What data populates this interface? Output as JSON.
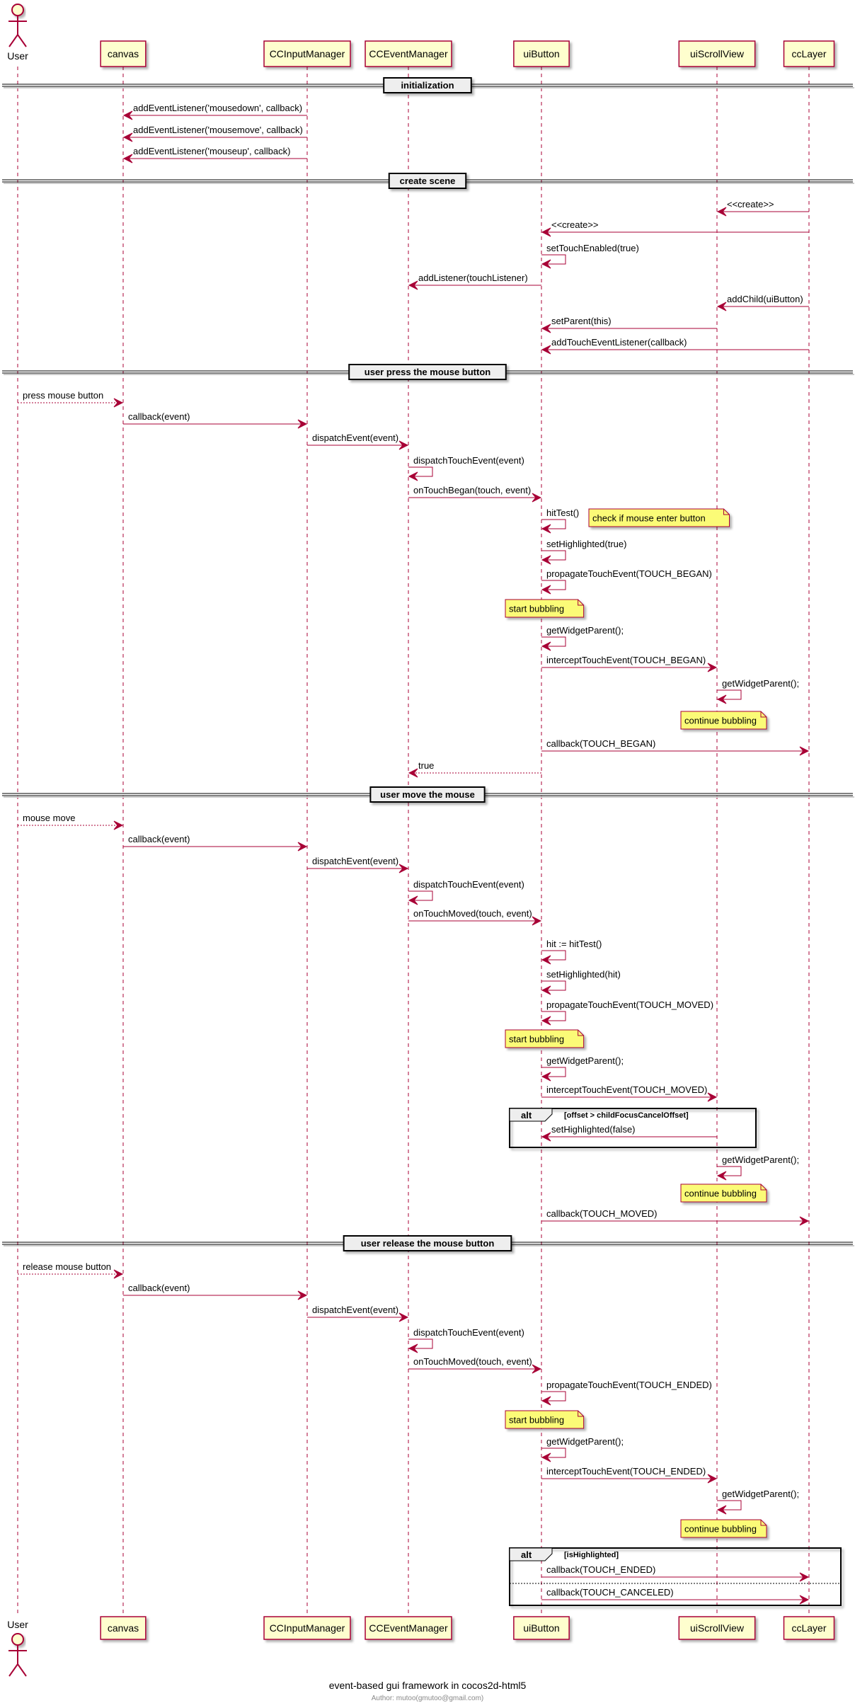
{
  "title": "event-based gui framework in cocos2d-html5",
  "footer": "Author: mutoo(gmutoo@gmail.com)",
  "colors": {
    "line": "#A80036",
    "participant_fill": "#FEFECE",
    "note_fill": "#FBFB77",
    "divider_fill": "#EEEEEE",
    "frame": "#000000"
  },
  "participants": [
    {
      "id": "user",
      "label": "User",
      "kind": "actor"
    },
    {
      "id": "canvas",
      "label": "canvas",
      "kind": "participant"
    },
    {
      "id": "input",
      "label": "CCInputManager",
      "kind": "participant"
    },
    {
      "id": "event",
      "label": "CCEventManager",
      "kind": "participant"
    },
    {
      "id": "button",
      "label": "uiButton",
      "kind": "participant"
    },
    {
      "id": "scroll",
      "label": "uiScrollView",
      "kind": "participant"
    },
    {
      "id": "layer",
      "label": "ccLayer",
      "kind": "participant"
    }
  ],
  "sequence": [
    {
      "type": "divider",
      "label": "initialization"
    },
    {
      "type": "message",
      "from": "input",
      "to": "canvas",
      "label": "addEventListener('mousedown', callback)",
      "style": "solid"
    },
    {
      "type": "message",
      "from": "input",
      "to": "canvas",
      "label": "addEventListener('mousemove', callback)",
      "style": "solid"
    },
    {
      "type": "message",
      "from": "input",
      "to": "canvas",
      "label": "addEventListener('mouseup', callback)",
      "style": "solid"
    },
    {
      "type": "divider",
      "label": "create scene"
    },
    {
      "type": "message",
      "from": "layer",
      "to": "scroll",
      "label": "<<create>>",
      "style": "solid"
    },
    {
      "type": "message",
      "from": "layer",
      "to": "button",
      "label": "<<create>>",
      "style": "solid"
    },
    {
      "type": "self",
      "on": "button",
      "label": "setTouchEnabled(true)"
    },
    {
      "type": "message",
      "from": "button",
      "to": "event",
      "label": "addListener(touchListener)",
      "style": "solid"
    },
    {
      "type": "message",
      "from": "layer",
      "to": "scroll",
      "label": "addChild(uiButton)",
      "style": "solid"
    },
    {
      "type": "message",
      "from": "scroll",
      "to": "button",
      "label": "setParent(this)",
      "style": "solid"
    },
    {
      "type": "message",
      "from": "layer",
      "to": "button",
      "label": "addTouchEventListener(callback)",
      "style": "solid"
    },
    {
      "type": "divider",
      "label": "user press the mouse button"
    },
    {
      "type": "message",
      "from": "user",
      "to": "canvas",
      "label": "press mouse button",
      "style": "dotted"
    },
    {
      "type": "message",
      "from": "canvas",
      "to": "input",
      "label": "callback(event)",
      "style": "solid"
    },
    {
      "type": "message",
      "from": "input",
      "to": "event",
      "label": "dispatchEvent(event)",
      "style": "solid"
    },
    {
      "type": "self",
      "on": "event",
      "label": "dispatchTouchEvent(event)"
    },
    {
      "type": "message",
      "from": "event",
      "to": "button",
      "label": "onTouchBegan(touch, event)",
      "style": "solid"
    },
    {
      "type": "self",
      "on": "button",
      "label": "hitTest()",
      "note": "check if mouse enter button"
    },
    {
      "type": "self",
      "on": "button",
      "label": "setHighlighted(true)"
    },
    {
      "type": "self",
      "on": "button",
      "label": "propagateTouchEvent(TOUCH_BEGAN)"
    },
    {
      "type": "note",
      "over": "button",
      "label": "start bubbling"
    },
    {
      "type": "self",
      "on": "button",
      "label": "getWidgetParent();"
    },
    {
      "type": "message",
      "from": "button",
      "to": "scroll",
      "label": "interceptTouchEvent(TOUCH_BEGAN)",
      "style": "solid"
    },
    {
      "type": "self",
      "on": "scroll",
      "label": "getWidgetParent();"
    },
    {
      "type": "note",
      "over": "scroll",
      "label": "continue bubbling"
    },
    {
      "type": "message",
      "from": "button",
      "to": "layer",
      "label": "callback(TOUCH_BEGAN)",
      "style": "solid"
    },
    {
      "type": "message",
      "from": "button",
      "to": "event",
      "label": "true",
      "style": "dotted"
    },
    {
      "type": "divider",
      "label": "user move the mouse"
    },
    {
      "type": "message",
      "from": "user",
      "to": "canvas",
      "label": "mouse move",
      "style": "dotted"
    },
    {
      "type": "message",
      "from": "canvas",
      "to": "input",
      "label": "callback(event)",
      "style": "solid"
    },
    {
      "type": "message",
      "from": "input",
      "to": "event",
      "label": "dispatchEvent(event)",
      "style": "solid"
    },
    {
      "type": "self",
      "on": "event",
      "label": "dispatchTouchEvent(event)"
    },
    {
      "type": "message",
      "from": "event",
      "to": "button",
      "label": "onTouchMoved(touch, event)",
      "style": "solid"
    },
    {
      "type": "self",
      "on": "button",
      "label": "hit := hitTest()"
    },
    {
      "type": "self",
      "on": "button",
      "label": "setHighlighted(hit)"
    },
    {
      "type": "self",
      "on": "button",
      "label": "propagateTouchEvent(TOUCH_MOVED)"
    },
    {
      "type": "note",
      "over": "button",
      "label": "start bubbling"
    },
    {
      "type": "self",
      "on": "button",
      "label": "getWidgetParent();"
    },
    {
      "type": "message",
      "from": "button",
      "to": "scroll",
      "label": "interceptTouchEvent(TOUCH_MOVED)",
      "style": "solid"
    },
    {
      "type": "alt",
      "keyword": "alt",
      "guard": "[offset > childFocusCancelOffset]",
      "sections": [
        [
          {
            "type": "message",
            "from": "scroll",
            "to": "button",
            "label": "setHighlighted(false)",
            "style": "solid"
          }
        ]
      ]
    },
    {
      "type": "self",
      "on": "scroll",
      "label": "getWidgetParent();"
    },
    {
      "type": "note",
      "over": "scroll",
      "label": "continue bubbling"
    },
    {
      "type": "message",
      "from": "button",
      "to": "layer",
      "label": "callback(TOUCH_MOVED)",
      "style": "solid"
    },
    {
      "type": "divider",
      "label": "user release the mouse button"
    },
    {
      "type": "message",
      "from": "user",
      "to": "canvas",
      "label": "release mouse button",
      "style": "dotted"
    },
    {
      "type": "message",
      "from": "canvas",
      "to": "input",
      "label": "callback(event)",
      "style": "solid"
    },
    {
      "type": "message",
      "from": "input",
      "to": "event",
      "label": "dispatchEvent(event)",
      "style": "solid"
    },
    {
      "type": "self",
      "on": "event",
      "label": "dispatchTouchEvent(event)"
    },
    {
      "type": "message",
      "from": "event",
      "to": "button",
      "label": "onTouchMoved(touch, event)",
      "style": "solid"
    },
    {
      "type": "self",
      "on": "button",
      "label": "propagateTouchEvent(TOUCH_ENDED)"
    },
    {
      "type": "note",
      "over": "button",
      "label": "start bubbling"
    },
    {
      "type": "self",
      "on": "button",
      "label": "getWidgetParent();"
    },
    {
      "type": "message",
      "from": "button",
      "to": "scroll",
      "label": "interceptTouchEvent(TOUCH_ENDED)",
      "style": "solid"
    },
    {
      "type": "self",
      "on": "scroll",
      "label": "getWidgetParent();"
    },
    {
      "type": "note",
      "over": "scroll",
      "label": "continue bubbling"
    },
    {
      "type": "alt",
      "keyword": "alt",
      "guard": "[isHighlighted]",
      "sections": [
        [
          {
            "type": "message",
            "from": "button",
            "to": "layer",
            "label": "callback(TOUCH_ENDED)",
            "style": "solid"
          }
        ],
        [
          {
            "type": "message",
            "from": "button",
            "to": "layer",
            "label": "callback(TOUCH_CANCELED)",
            "style": "solid"
          }
        ]
      ]
    }
  ]
}
